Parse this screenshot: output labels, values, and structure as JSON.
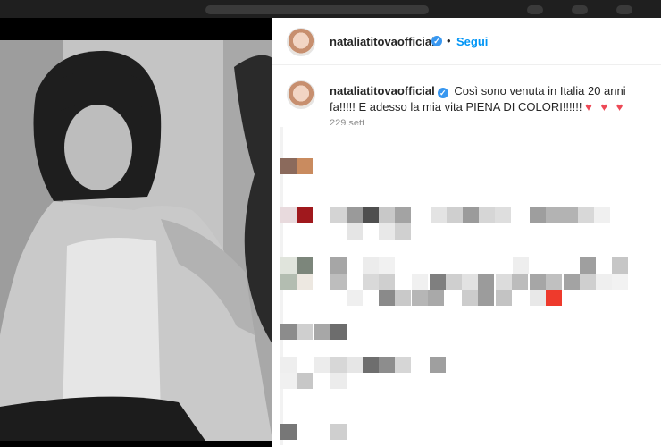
{
  "post": {
    "username": "nataliatitovaofficial",
    "verified_mark": "✓",
    "separator": "•",
    "follow_label": "Segui"
  },
  "caption": {
    "username": "nataliatitovaofficial",
    "text": "Così sono venuta in Italia 20 anni fa!!!!! E adesso la mia vita PIENA DI COLORI!!!!!!",
    "hearts": "♥ ♥ ♥",
    "meta": "229 sett"
  },
  "colors": {
    "follow": "#0095f6",
    "verified": "#3897f0",
    "heart": "#ed4956"
  }
}
